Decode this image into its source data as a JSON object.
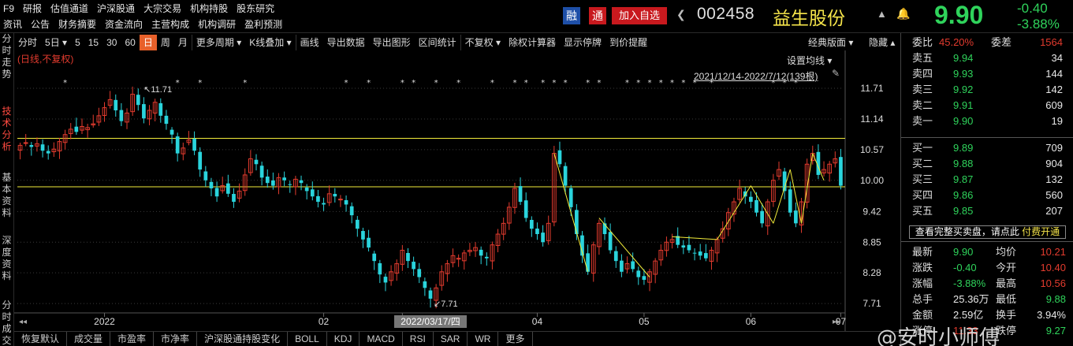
{
  "menu": {
    "row1": [
      "F9",
      "研报",
      "估值通道",
      "沪深股通",
      "大宗交易",
      "机构持股",
      "股东研究"
    ],
    "row2": [
      "资讯",
      "公告",
      "财务摘要",
      "资金流向",
      "主营构成",
      "机构调研",
      "盈利预测"
    ]
  },
  "header": {
    "badge_rong": "融",
    "badge_tong": "通",
    "add_watch": "加入自选",
    "prev_arrow": "❮",
    "code": "002458",
    "name": "益生股份",
    "next_arrow": "▲",
    "bell": "🔔",
    "price": "9.90",
    "change": "-0.40",
    "change_pct": "-3.88%"
  },
  "left_tabs": [
    "分时走势",
    "技术分析",
    "基本资料",
    "深度资料",
    "分时成交"
  ],
  "toolbar": {
    "items": [
      "分时",
      "5日 ▾",
      "5",
      "15",
      "30",
      "60",
      "日",
      "周",
      "月",
      "更多周期 ▾",
      "K线叠加 ▾",
      "画线",
      "导出数据",
      "导出图形",
      "区间统计",
      "不复权 ▾",
      "除权计算器",
      "显示停牌",
      "到价提醒"
    ],
    "active_index": 6,
    "classic": "经典版面 ▾",
    "hide": "隐藏 ▴"
  },
  "chart_info": {
    "note": "(日线,不复权)",
    "ma_settings": "设置均线 ▾",
    "date_range": "2021/12/14-2022/7/12(139根)",
    "pin": "✎",
    "high_label": "11.71",
    "low_label": "7.71",
    "crosshair_date": "2022/03/17/四"
  },
  "chart_data": {
    "type": "candlestick",
    "x_range": [
      "2021/12/14",
      "2022/7/12"
    ],
    "bars": 139,
    "y_ticks": [
      11.71,
      11.14,
      10.57,
      10.0,
      9.42,
      8.85,
      8.28,
      7.71
    ],
    "ylim": [
      7.55,
      12.15
    ],
    "x_labels": [
      "2022",
      "02",
      "03",
      "04",
      "05",
      "06",
      "07"
    ],
    "x_label_dates": [
      "2022/01/04",
      "2022/02/07",
      "2022/03/01",
      "2022/04/06",
      "2022/05/05",
      "2022/06/01",
      "2022/07/01"
    ],
    "hlines": [
      10.78,
      9.88
    ],
    "max_point": {
      "value": 11.71,
      "date": "2022/01/12"
    },
    "min_point": {
      "value": 7.71,
      "date": "2022/03/17"
    },
    "marker_columns": [
      8,
      28,
      32,
      40,
      58,
      62,
      68,
      70,
      74,
      78,
      84,
      88,
      90,
      93,
      95,
      97,
      101,
      103,
      108,
      110,
      112,
      114,
      116,
      118,
      120,
      123,
      134,
      136,
      138
    ],
    "waves": [
      [
        [
          95,
          10.5
        ],
        [
          101,
          8.3
        ]
      ],
      [
        [
          103,
          9.3
        ],
        [
          112,
          8.2
        ]
      ],
      [
        [
          116,
          8.95
        ],
        [
          124,
          8.9
        ]
      ],
      [
        [
          124,
          8.9
        ],
        [
          130,
          9.9
        ]
      ],
      [
        [
          130,
          9.9
        ],
        [
          134,
          9.2
        ]
      ],
      [
        [
          134,
          9.2
        ],
        [
          137,
          10.2
        ]
      ],
      [
        [
          137,
          10.2
        ],
        [
          139,
          9.2
        ]
      ],
      [
        [
          139,
          9.2
        ],
        [
          141,
          10.5
        ]
      ],
      [
        [
          141,
          10.5
        ],
        [
          143,
          10.0
        ]
      ]
    ],
    "closes": [
      10.65,
      10.7,
      10.62,
      10.68,
      10.55,
      10.5,
      10.58,
      10.72,
      10.85,
      10.95,
      10.9,
      11.0,
      10.98,
      11.05,
      11.2,
      11.35,
      11.5,
      11.3,
      11.1,
      11.25,
      11.6,
      11.4,
      11.15,
      11.3,
      11.45,
      11.2,
      11.05,
      10.85,
      10.5,
      10.6,
      10.75,
      10.55,
      10.2,
      10.0,
      9.85,
      9.7,
      9.9,
      9.75,
      9.6,
      9.8,
      10.1,
      10.4,
      10.3,
      10.05,
      9.95,
      9.9,
      10.05,
      10.0,
      9.92,
      10.02,
      9.95,
      9.8,
      9.7,
      9.6,
      9.55,
      9.75,
      9.7,
      9.65,
      9.55,
      9.35,
      9.1,
      8.9,
      8.75,
      8.5,
      8.25,
      8.1,
      8.3,
      8.45,
      8.7,
      8.5,
      8.35,
      8.2,
      8.0,
      7.8,
      8.0,
      8.3,
      8.45,
      8.6,
      8.55,
      8.65,
      8.7,
      8.75,
      8.6,
      8.55,
      8.8,
      9.0,
      9.2,
      9.5,
      9.85,
      9.6,
      9.3,
      9.1,
      9.0,
      8.85,
      9.2,
      10.5,
      10.3,
      9.9,
      9.5,
      9.0,
      8.6,
      8.3,
      8.8,
      9.2,
      9.0,
      8.7,
      8.5,
      8.3,
      8.45,
      8.35,
      8.2,
      8.15,
      8.3,
      8.5,
      8.7,
      8.85,
      8.9,
      8.8,
      8.75,
      8.7,
      8.65,
      8.6,
      8.55,
      8.7,
      8.9,
      9.1,
      9.4,
      9.6,
      9.85,
      9.7,
      9.6,
      9.4,
      9.2,
      9.6,
      10.0,
      10.2,
      9.8,
      9.4,
      9.2,
      9.6,
      10.3,
      10.5,
      10.1,
      10.2,
      10.3,
      10.4,
      9.9
    ]
  },
  "order_book": {
    "weibi_label": "委比",
    "weibi_value": "45.20%",
    "weicha_label": "委差",
    "weicha_value": "1564",
    "asks": [
      {
        "label": "卖五",
        "price": "9.94",
        "vol": "34"
      },
      {
        "label": "卖四",
        "price": "9.93",
        "vol": "144"
      },
      {
        "label": "卖三",
        "price": "9.92",
        "vol": "142"
      },
      {
        "label": "卖二",
        "price": "9.91",
        "vol": "609"
      },
      {
        "label": "卖一",
        "price": "9.90",
        "vol": "19"
      }
    ],
    "bids": [
      {
        "label": "买一",
        "price": "9.89",
        "vol": "709"
      },
      {
        "label": "买二",
        "price": "9.88",
        "vol": "904"
      },
      {
        "label": "买三",
        "price": "9.87",
        "vol": "132"
      },
      {
        "label": "买四",
        "price": "9.86",
        "vol": "560"
      },
      {
        "label": "买五",
        "price": "9.85",
        "vol": "207"
      }
    ],
    "full_book_text": "查看完整买卖盘，请点此",
    "full_book_link": "付费开通"
  },
  "stats": [
    {
      "l": "最新",
      "lv": "9.90",
      "lc": "green",
      "r": "均价",
      "rv": "10.21",
      "rc": "red"
    },
    {
      "l": "涨跌",
      "lv": "-0.40",
      "lc": "green",
      "r": "今开",
      "rv": "10.40",
      "rc": "red"
    },
    {
      "l": "涨幅",
      "lv": "-3.88%",
      "lc": "green",
      "r": "最高",
      "rv": "10.56",
      "rc": "red"
    },
    {
      "l": "总手",
      "lv": "25.36万",
      "lc": "white",
      "r": "最低",
      "rv": "9.88",
      "rc": "green"
    },
    {
      "l": "金额",
      "lv": "2.59亿",
      "lc": "white",
      "r": "换手",
      "rv": "3.94%",
      "rc": "white"
    },
    {
      "l": "涨停",
      "lv": "11.33",
      "lc": "red",
      "r": "跌停",
      "rv": "9.27",
      "rc": "green"
    }
  ],
  "indicator_tabs": [
    "恢复默认",
    "成交量",
    "市盈率",
    "市净率",
    "沪深股通持股变化",
    "BOLL",
    "KDJ",
    "MACD",
    "RSI",
    "SAR",
    "WR",
    "更多"
  ],
  "watermark": "@安时小师傅",
  "colors": {
    "up": "#e23b2e",
    "down": "#2ad4dc",
    "accent": "#e8602a",
    "hline": "#f2ec3a"
  }
}
